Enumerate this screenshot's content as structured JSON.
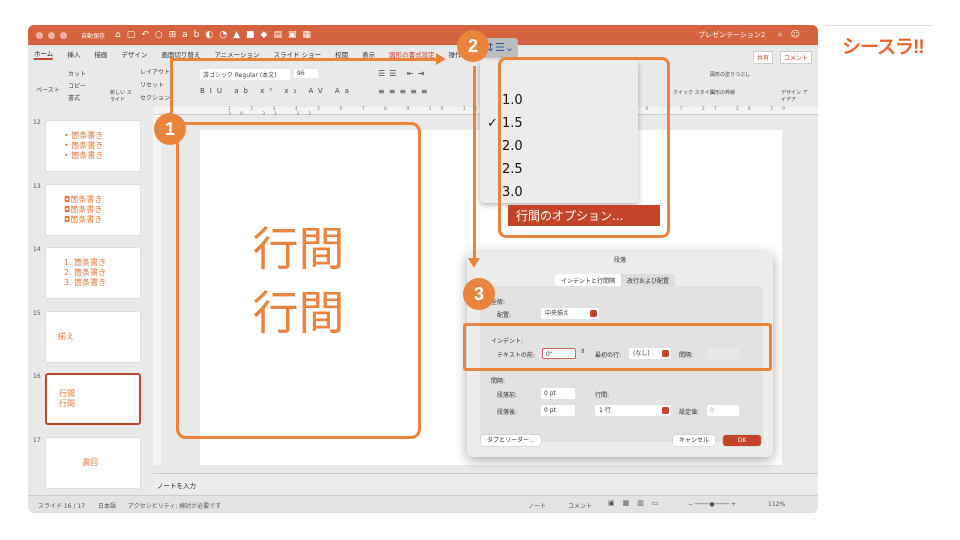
{
  "window": {
    "title": "プレゼンテーション2",
    "autosave": "自動保存",
    "autosave_state": "オフ"
  },
  "tabs": [
    "ホーム",
    "挿入",
    "描画",
    "デザイン",
    "画面切り替え",
    "アニメーション",
    "スライド ショー",
    "校閲",
    "表示",
    "図形の書式設定",
    "操作"
  ],
  "share": "共有",
  "comment": "コメント",
  "ribbon": {
    "paste": "ペースト",
    "cut": "カット",
    "copy": "コピー",
    "format": "書式",
    "new_slide": "新しい スライド",
    "layout": "レイアウト",
    "reset": "リセット",
    "section": "セクション",
    "font": "游ゴシック Regular (本文)",
    "size": "96",
    "quick_style": "クイック スタイル",
    "shape_fill": "図形の塗りつぶし",
    "shape_outline": "図形の枠線",
    "design_ideas": "デザイン アイデア"
  },
  "ruler_ticks": "1 2 3 4 5 6 7 8 9 10 11 12 13 14 15 16 17 27 28 29 30 31 32",
  "thumbnails": [
    {
      "num": "12",
      "lines": [
        "• 箇条書き",
        "• 箇条書き",
        "• 箇条書き"
      ]
    },
    {
      "num": "13",
      "lines": [
        "◘箇条書き",
        "◘箇条書き",
        "◘箇条書き"
      ]
    },
    {
      "num": "14",
      "lines": [
        "1. 箇条書き",
        "2. 箇条書き",
        "3. 箇条書き"
      ]
    },
    {
      "num": "15",
      "lines": [
        "揃え"
      ]
    },
    {
      "num": "16",
      "lines": [
        "行間",
        "行間"
      ]
    },
    {
      "num": "17",
      "lines": [
        "書回"
      ]
    }
  ],
  "slide": {
    "lines": [
      "行間",
      "行間"
    ]
  },
  "notes_placeholder": "ノートを入力",
  "status": {
    "slide": "スライド 16 / 17",
    "lang": "日本語",
    "accessibility": "アクセシビリティ: 検討が必要です",
    "notes": "ノート",
    "comments": "コメント",
    "zoom": "112%"
  },
  "line_spacing_menu": {
    "items": [
      "1.0",
      "1.5",
      "2.0",
      "2.5",
      "3.0"
    ],
    "selected": "1.5",
    "options": "行間のオプション..."
  },
  "dialog": {
    "title": "段落",
    "tabs": [
      "インデントと行間隔",
      "改行および配置"
    ],
    "general": "全般:",
    "alignment_label": "配置:",
    "alignment": "中央揃え",
    "indent": "インデント:",
    "before_text_label": "テキストの前:",
    "before_text": "0\"",
    "first_line_label": "最初の行:",
    "first_line": "(なし)",
    "by_label": "間隔:",
    "spacing": "間隔:",
    "before_label": "段落前:",
    "before": "0 pt",
    "after_label": "段落後:",
    "after": "0 pt",
    "line_spacing_label": "行間:",
    "line_spacing": "1 行",
    "at_label": "設定値:",
    "at": "0",
    "tabs_button": "タブとリーダー...",
    "cancel": "キャンセル",
    "ok": "OK"
  },
  "callouts": [
    "1",
    "2",
    "3"
  ],
  "logo": "シースラ!!",
  "colors": {
    "accent": "#e8843c",
    "brand": "#d4643f",
    "selected": "#c4442a"
  }
}
